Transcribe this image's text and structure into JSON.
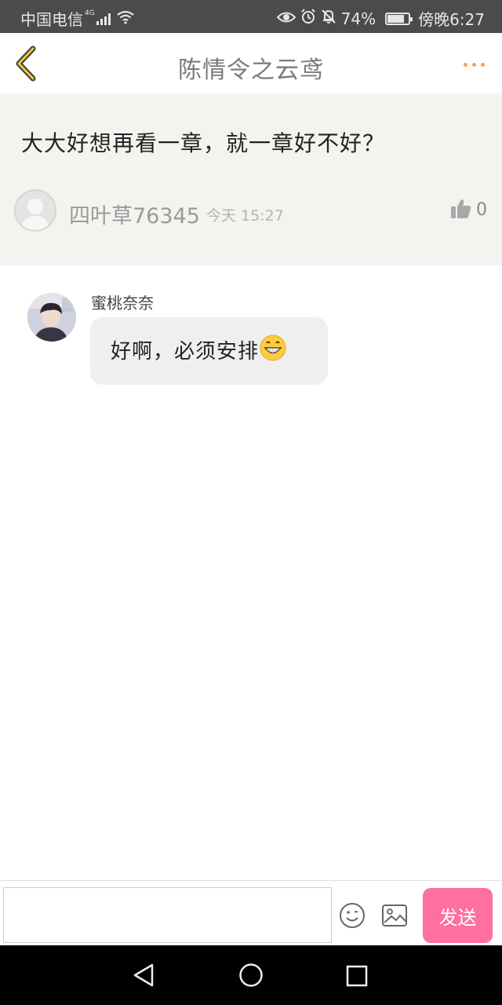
{
  "status_bar": {
    "carrier": "中国电信",
    "network": "4G",
    "battery": "74%",
    "battery_level": 0.74,
    "time": "傍晚6:27",
    "icons": [
      "signal-icon",
      "wifi-icon",
      "eye-icon",
      "alarm-icon",
      "mute-icon",
      "battery-icon"
    ]
  },
  "header": {
    "title": "陈情令之云鸢",
    "back_icon": "chevron-left-icon",
    "more_icon": "more-dots-icon"
  },
  "post": {
    "text": "大大好想再看一章，就一章好不好？",
    "author": "四叶草76345",
    "time": "今天 15:27",
    "likes": "0"
  },
  "reply": {
    "author": "蜜桃奈奈",
    "text": "好啊，必须安排",
    "emoji": "grinning-face-emoji"
  },
  "input_bar": {
    "placeholder": "",
    "send_label": "发送",
    "accent_color": "#ff6fa0"
  },
  "colors": {
    "status_bar_bg": "#4b4b4b",
    "post_bg": "#f3f3ef",
    "bubble_bg": "#efefef",
    "more_dots": "#f2a15e",
    "back_chevron": "#e8c84a"
  }
}
